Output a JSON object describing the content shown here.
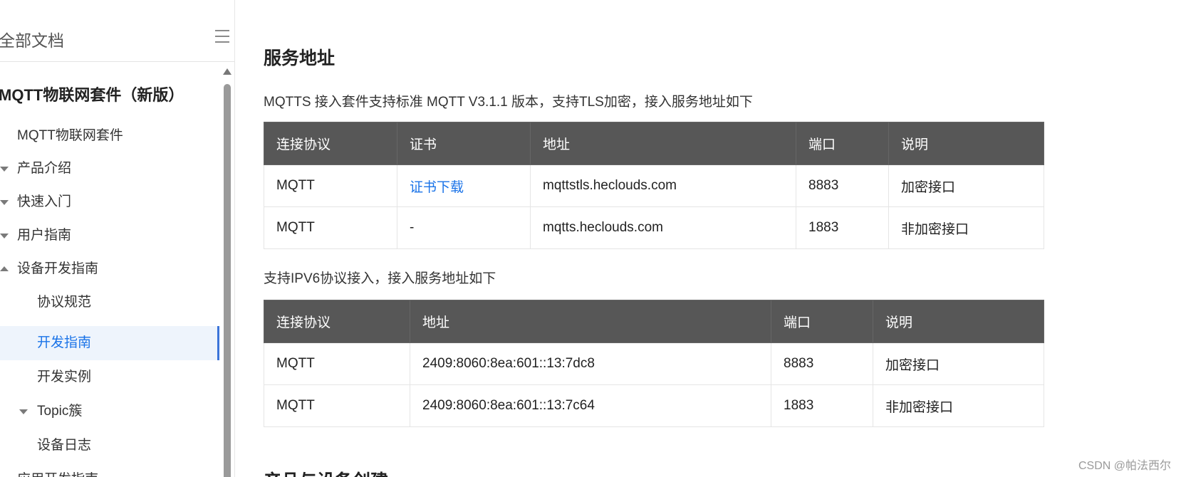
{
  "sidebar": {
    "title": "全部文档",
    "menu_icon": "hamburger-icon",
    "section_title": "MQTT物联网套件（新版）",
    "items": [
      {
        "label": "MQTT物联网套件",
        "caret": "none"
      },
      {
        "label": "产品介绍",
        "caret": "collapsed"
      },
      {
        "label": "快速入门",
        "caret": "collapsed"
      },
      {
        "label": "用户指南",
        "caret": "collapsed"
      },
      {
        "label": "设备开发指南",
        "caret": "expanded"
      },
      {
        "label": "协议规范",
        "caret": "none"
      },
      {
        "label": "开发指南",
        "caret": "none",
        "active": true
      },
      {
        "label": "开发实例",
        "caret": "none"
      },
      {
        "label": "Topic簇",
        "caret": "collapsed"
      },
      {
        "label": "设备日志",
        "caret": "none"
      },
      {
        "label": "应用开发指南",
        "caret": "collapsed"
      }
    ]
  },
  "main": {
    "heading": "服务地址",
    "intro": "MQTTS 接入套件支持标准 MQTT V3.1.1 版本，支持TLS加密，接入服务地址如下",
    "table1": {
      "headers": [
        "连接协议",
        "证书",
        "地址",
        "端口",
        "说明"
      ],
      "rows": [
        [
          "MQTT",
          "证书下载",
          "mqttstls.heclouds.com",
          "8883",
          "加密接口"
        ],
        [
          "MQTT",
          "-",
          "mqtts.heclouds.com",
          "1883",
          "非加密接口"
        ]
      ]
    },
    "ipv6_intro": "支持IPV6协议接入，接入服务地址如下",
    "table2": {
      "headers": [
        "连接协议",
        "地址",
        "端口",
        "说明"
      ],
      "rows": [
        [
          "MQTT",
          "2409:8060:8ea:601::13:7dc8",
          "8883",
          "加密接口"
        ],
        [
          "MQTT",
          "2409:8060:8ea:601::13:7c64",
          "1883",
          "非加密接口"
        ]
      ]
    },
    "next_heading": "产品与设备创建"
  },
  "watermark": "CSDN @帕法西尔",
  "colors": {
    "table_header_bg": "#575757",
    "link": "#1a73e8",
    "active_item_bg": "#eef4fc",
    "active_indicator": "#3b74d9"
  }
}
